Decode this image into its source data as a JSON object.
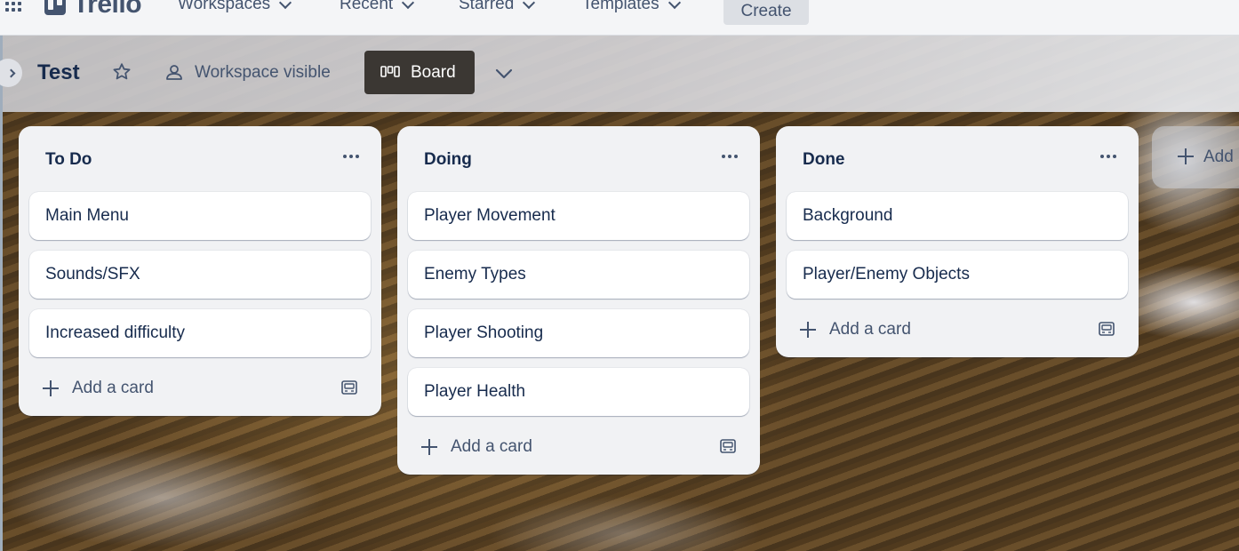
{
  "topbar": {
    "logo_text": "Trello",
    "nav": [
      {
        "label": "Workspaces"
      },
      {
        "label": "Recent"
      },
      {
        "label": "Starred"
      },
      {
        "label": "Templates"
      }
    ],
    "create_label": "Create"
  },
  "board": {
    "title": "Test",
    "visibility_label": "Workspace visible",
    "view_label": "Board",
    "icons": [
      "chevron-right-icon",
      "star-icon",
      "people-icon",
      "board-view-icon",
      "chevron-down-icon"
    ]
  },
  "lists": [
    {
      "title": "To Do",
      "cards": [
        "Main Menu",
        "Sounds/SFX",
        "Increased difficulty"
      ],
      "add_card_label": "Add a card"
    },
    {
      "title": "Doing",
      "cards": [
        "Player Movement",
        "Enemy Types",
        "Player Shooting",
        "Player Health"
      ],
      "add_card_label": "Add a card"
    },
    {
      "title": "Done",
      "cards": [
        "Background",
        "Player/Enemy Objects"
      ],
      "add_card_label": "Add a card"
    }
  ],
  "add_list_label": "Add",
  "colors": {
    "list_bg": "#f1f2f4",
    "card_bg": "#ffffff",
    "text": "#172b4d",
    "subtle_text": "#44546f",
    "board_button_bg": "#3b3733"
  }
}
